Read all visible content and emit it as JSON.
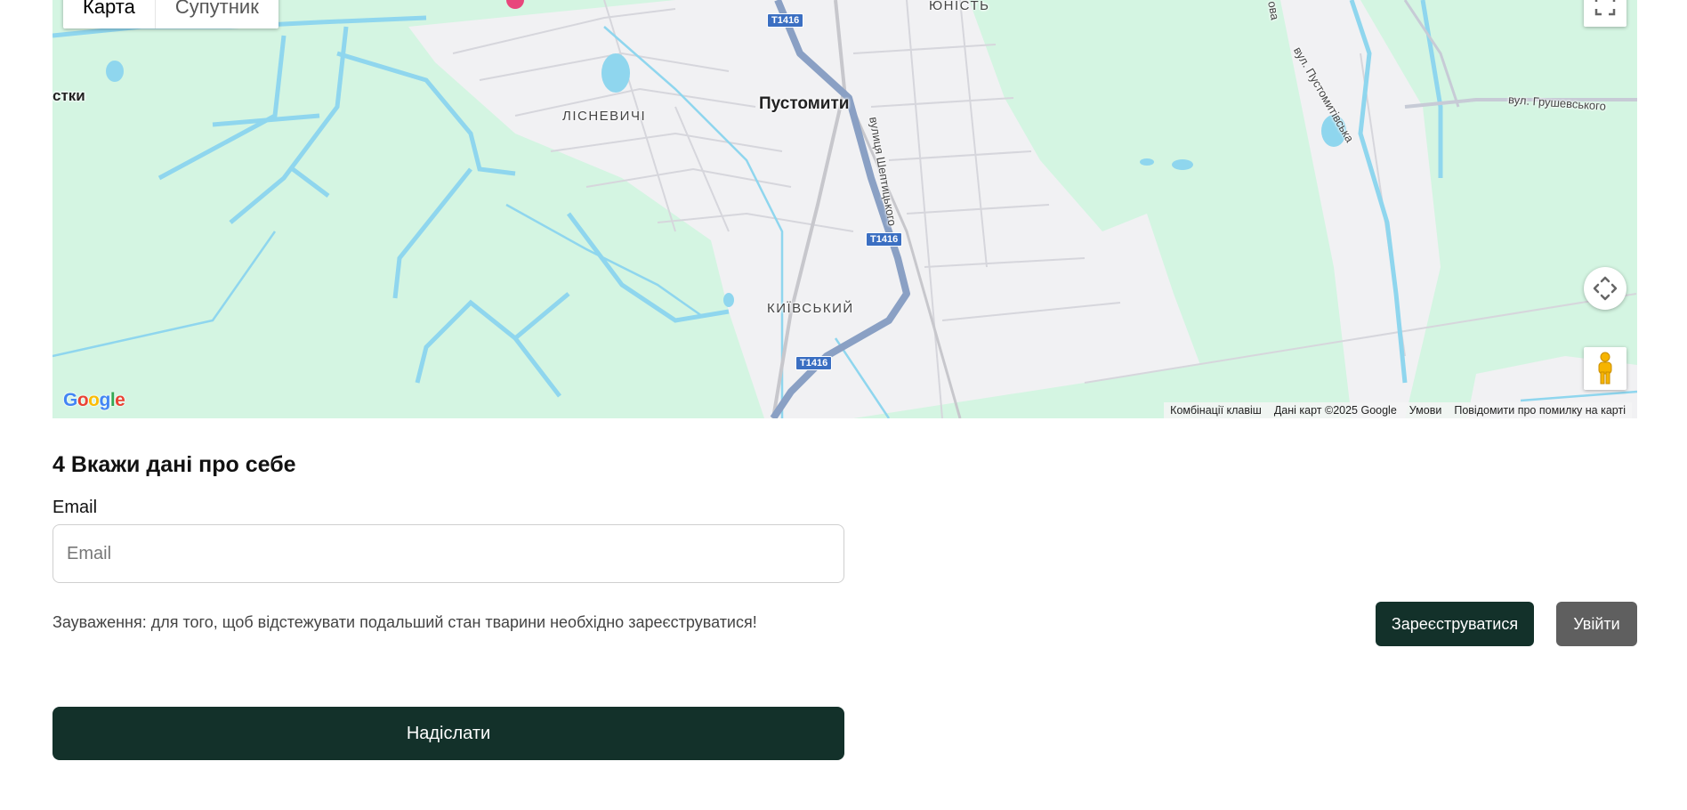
{
  "map": {
    "type_buttons": {
      "map": "Карта",
      "satellite": "Супутник"
    },
    "places": {
      "pustomyty": "Пустомити",
      "lisnevychi": "ЛІСНЕВИЧІ",
      "kyivskyi": "КИЇВСЬКИЙ",
      "yunist": "ЮНІСТЬ",
      "left_cut": "стки",
      "vul_sheptytskoho": "вулиця Шептицького",
      "vul_pustomytivska": "вул. Пустомитівська",
      "vul_hrushevskoho": "вул. Грушевського",
      "left_top_cut": "ова"
    },
    "road_shield": "T1416",
    "logo": "Google",
    "attribution": {
      "shortcuts": "Комбінації клавіш",
      "data": "Дані карт ©2025 Google",
      "terms": "Умови",
      "report": "Повідомити про помилку на карті"
    },
    "colors": {
      "park": "#d4f5e2",
      "urban": "#f1f1f3",
      "water": "#8fd6ee",
      "highway": "#8aa0c4"
    }
  },
  "form": {
    "section_title": "4 Вкажи дані про себе",
    "email_label": "Email",
    "email_placeholder": "Email",
    "email_value": "",
    "note": "Зауваження: для того, щоб відстежувати подальший стан тварини необхідно зареєструватися!",
    "register_button": "Зареєструватися",
    "login_button": "Увійти",
    "submit_button": "Надіслати",
    "colors": {
      "primary": "#13312a",
      "secondary": "#5f5f5f"
    }
  }
}
